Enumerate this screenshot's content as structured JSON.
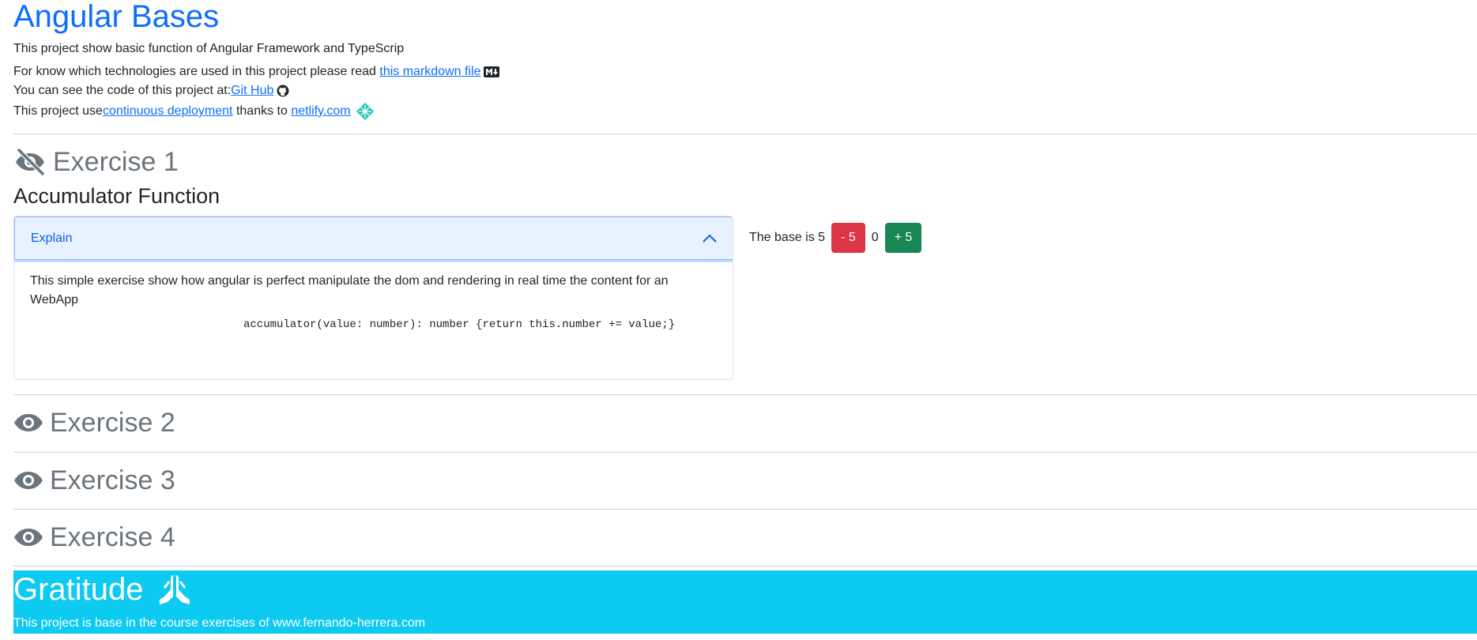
{
  "header": {
    "title": "Angular Bases",
    "subtitle": "This project show basic function of Angular Framework and TypeScrip",
    "tech_text": "For know which technologies are used in this project please read ",
    "tech_link": "this markdown file",
    "code_text": "You can see the code of this project at: ",
    "code_link": "Git Hub",
    "deploy_text": "This project use ",
    "deploy_link": "continuous deployment",
    "deploy_mid": " thanks to ",
    "netlify_link": "netlify.com"
  },
  "exercises": [
    {
      "label": "Exercise 1",
      "icon": "eye-slash-icon"
    },
    {
      "label": "Exercise 2",
      "icon": "eye-icon"
    },
    {
      "label": "Exercise 3",
      "icon": "eye-icon"
    },
    {
      "label": "Exercise 4",
      "icon": "eye-icon"
    }
  ],
  "exercise1": {
    "heading": "Accumulator Function",
    "accordion_label": "Explain",
    "explanation": "This simple exercise show how angular is perfect manipulate the dom and rendering in real time the content for an WebApp",
    "code": "accumulator(value: number): number {return this.number += value;}",
    "base_text": "The base is 5",
    "minus_label": "- 5",
    "count": "0",
    "plus_label": "+ 5"
  },
  "gratitude": {
    "title": "Gratitude",
    "text": "This project is base in the course exercises of www.fernando-herrera.com"
  },
  "colors": {
    "primary": "#0d6efd",
    "danger": "#dc3545",
    "success": "#198754",
    "info": "#0dcaf0",
    "muted": "#6c757d"
  }
}
